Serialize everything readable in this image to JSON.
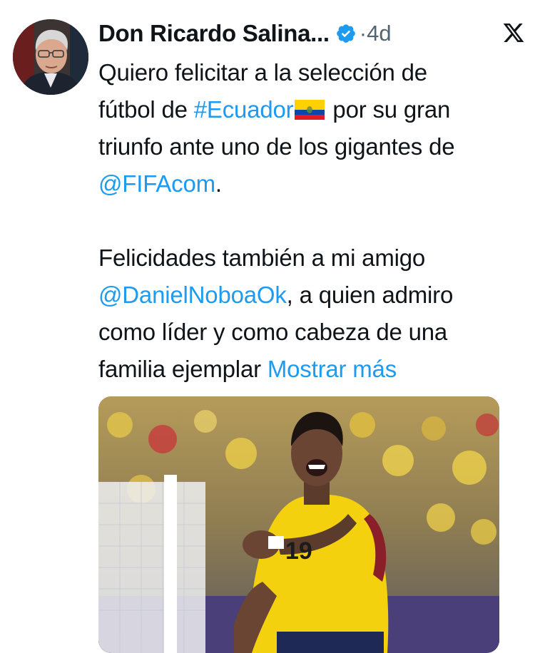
{
  "author": {
    "name": "Don Ricardo Salina...",
    "separator": "·",
    "time": "4d"
  },
  "tweet": {
    "p1_a": "Quiero felicitar a la selección de",
    "p1_b": "fútbol de ",
    "hashtag": "#Ecuador",
    "p1_c": " por su gran",
    "p1_d": "triunfo ante uno de los gigantes de",
    "mention1": "@FIFAcom",
    "p1_e": ".",
    "p2_a": "Felicidades también a mi amigo",
    "mention2": "@DanielNoboaOk",
    "p2_b": ", a quien admiro",
    "p2_c": "como líder y como cabeza de una",
    "p2_d": "familia ejemplar ",
    "show_more": "Mostrar más"
  },
  "media": {
    "jersey_number": "19"
  },
  "colors": {
    "link": "#1d9bf0",
    "verified": "#1d9bf0",
    "muted": "#536471",
    "text": "#0f1419"
  }
}
